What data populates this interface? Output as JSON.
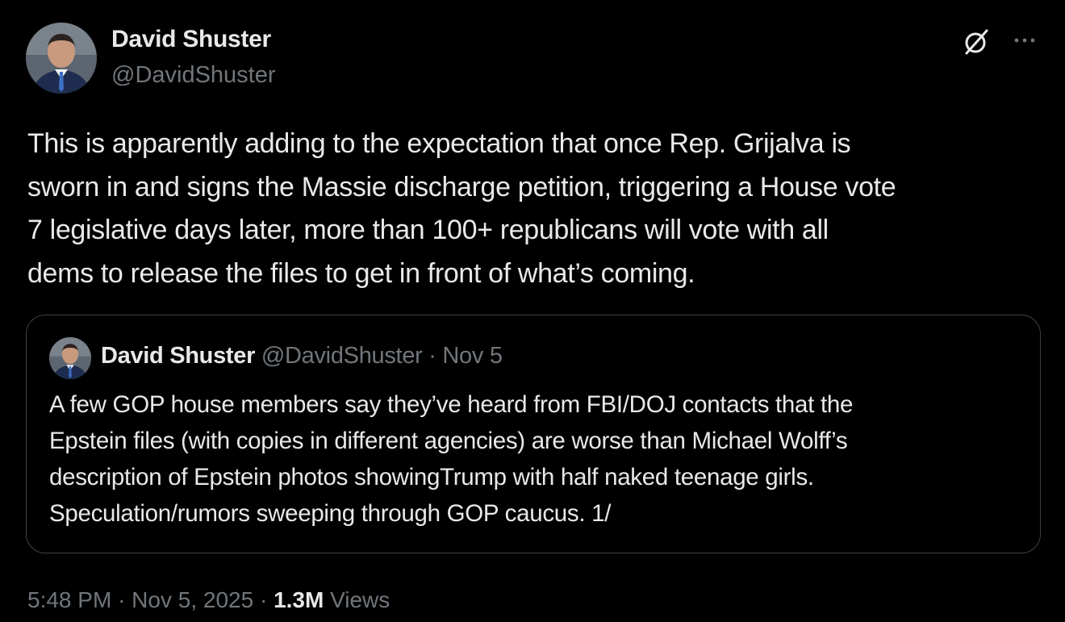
{
  "tweet": {
    "author": {
      "name": "David Shuster",
      "handle": "@DavidShuster",
      "avatar": "avatar-photo"
    },
    "text_lines": [
      "This is apparently adding to the expectation that once Rep. Grijalva is",
      "sworn in and signs the Massie discharge petition, triggering a House vote",
      "7 legislative days later, more than 100+ republicans will vote with all",
      "dems to release the files to get in front of what’s coming."
    ],
    "actions": {
      "grok_icon": "grok-icon",
      "more_icon": "more-icon"
    },
    "quote": {
      "name": "David Shuster",
      "handle": "@DavidShuster",
      "separator": "·",
      "date": "Nov 5",
      "text_lines": [
        "A few GOP house members say they’ve heard from FBI/DOJ contacts that the",
        "Epstein files (with copies in different agencies) are worse than Michael Wolff’s",
        "description of Epstein photos showingTrump with half naked teenage girls.",
        "Speculation/rumors sweeping through GOP caucus. 1/"
      ]
    },
    "meta": {
      "time": "5:48 PM",
      "separator": "·",
      "date": "Nov 5, 2025",
      "views_count": "1.3M",
      "views_label": "Views"
    }
  },
  "colors": {
    "background": "#000000",
    "primary_text": "#e7e9ea",
    "secondary_text": "#71767b",
    "border": "#3e4144"
  }
}
